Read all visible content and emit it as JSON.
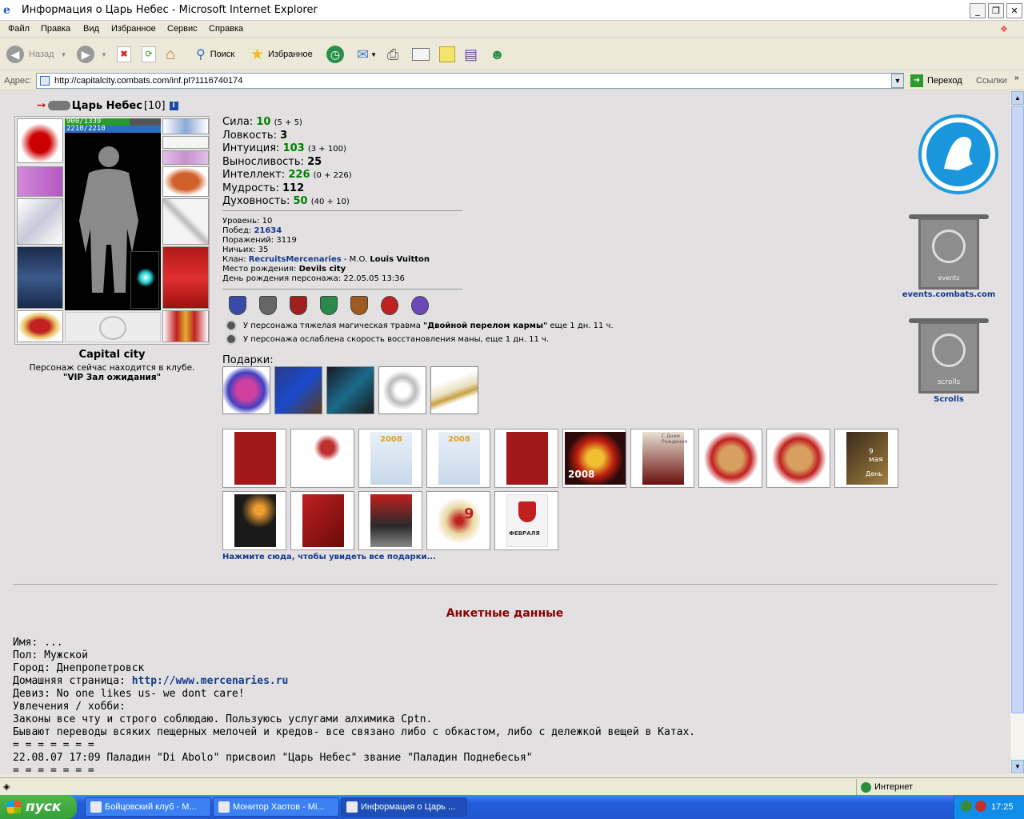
{
  "window": {
    "title": "Информация о Царь Небес - Microsoft Internet Explorer"
  },
  "menu": [
    "Файл",
    "Правка",
    "Вид",
    "Избранное",
    "Сервис",
    "Справка"
  ],
  "toolbar": {
    "back": "Назад",
    "search": "Поиск",
    "favorites": "Избранное"
  },
  "address": {
    "label": "Адрес:",
    "url": "http://capitalcity.combats.com/inf.pl?1116740174",
    "go": "Переход",
    "links": "Ссылки"
  },
  "character": {
    "name": "Царь Небес",
    "level": "[10]",
    "hp": "900/1339",
    "mana": "2210/2210",
    "hp_fraction": 0.672,
    "mana_fraction": 1.0,
    "city": "Capital city",
    "club_text": "Персонаж сейчас находится в клубе.",
    "club_room": "\"VIP Зал ожидания\""
  },
  "stats": [
    {
      "label": "Сила:",
      "value": "10",
      "extra": "(5 + 5)",
      "green": true
    },
    {
      "label": "Ловкость:",
      "value": "3",
      "extra": "",
      "green": false
    },
    {
      "label": "Интуиция:",
      "value": "103",
      "extra": "(3 + 100)",
      "green": true
    },
    {
      "label": "Выносливость:",
      "value": "25",
      "extra": "",
      "green": false
    },
    {
      "label": "Интеллект:",
      "value": "226",
      "extra": "(0 + 226)",
      "green": true
    },
    {
      "label": "Мудрость:",
      "value": "112",
      "extra": "",
      "green": false
    },
    {
      "label": "Духовность:",
      "value": "50",
      "extra": "(40 + 10)",
      "green": true
    }
  ],
  "info": {
    "level_label": "Уровень:",
    "level": "10",
    "wins_label": "Побед:",
    "wins": "21634",
    "losses_label": "Поражений:",
    "losses": "3119",
    "draws_label": "Ничьих:",
    "draws": "35",
    "clan_label": "Клан:",
    "clan": "RecruitsMercenaries",
    "clan_rank": "- M.O.",
    "clan_title": "Louis Vuitton",
    "birthplace_label": "Место рождения:",
    "birthplace": "Devils city",
    "birthday_label": "День рождения персонажа:",
    "birthday": "22.05.05 13:36"
  },
  "traumas": [
    {
      "pre": "У персонажа тяжелая магическая травма ",
      "bold": "\"Двойной перелом кармы\"",
      "post": " еще 1 дн. 11 ч."
    },
    {
      "pre": "У персонажа ослаблена скорость восстановления маны, еще 1 дн. 11 ч.",
      "bold": "",
      "post": ""
    }
  ],
  "gifts_label": "Подарки:",
  "see_all": "Нажмите сюда, чтобы увидеть все подарки...",
  "card_texts": [
    "2008",
    "2008",
    "2008",
    "С Днем Рождения",
    "9 мая",
    "День",
    "9",
    "ФЕВРАЛЯ"
  ],
  "right": {
    "events": "events.combats.com",
    "scrolls": "Scrolls",
    "events_banner": "events",
    "scrolls_banner": "scrolls"
  },
  "anket_title": "Анкетные данные",
  "profile": {
    "name": "Имя: ...",
    "gender": "Пол: Мужской",
    "city": "Город: Днепропетровск",
    "home_label": "Домашняя страница: ",
    "home_url": "http://www.mercenaries.ru",
    "motto": "Девиз: No one likes us- we dont care!",
    "hobby": "Увлечения / хобби:",
    "line1": "Законы все чту и строго соблюдаю. Пользуюсь услугами алхимика Cptn.",
    "line2": "Бывают переводы всяких пещерных мелочей и кредов- все связано либо с обкастом, либо с дележкой вещей в Катах.",
    "sep1": "= = = = = = =",
    "line3": "22.08.07 17:09 Паладин \"Di Abolo\" присвоил \"Царь Небес\" звание \"Паладин Поднебесья\"",
    "sep2": "= = = = = = ="
  },
  "status": {
    "zone": "Интернет"
  },
  "taskbar": {
    "start": "пуск",
    "tasks": [
      "Бойцовский клуб - М...",
      "Монитор Хаотов - Mi...",
      "Информация о Царь ..."
    ],
    "clock": "17:25"
  },
  "colors": {
    "hp": "#2a9a2a",
    "mana": "#2a6fbf",
    "green_stat": "#008000",
    "link": "#153a8e",
    "anket": "#8b0000"
  }
}
